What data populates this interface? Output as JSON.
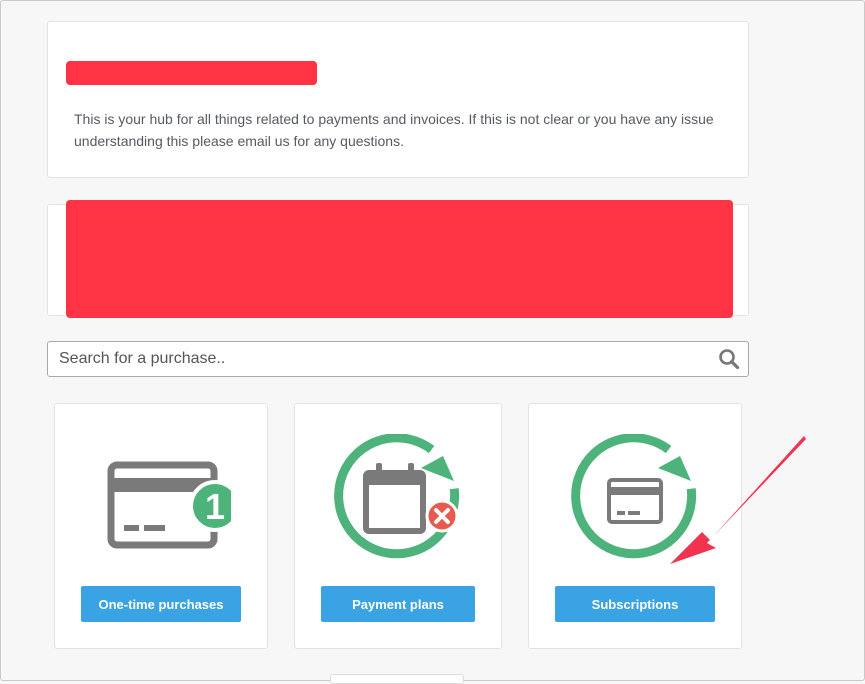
{
  "hub": {
    "description": "This is your hub for all things related to payments and invoices. If this is not clear or you have any issue understanding this please email us for any questions."
  },
  "search": {
    "placeholder": "Search for a purchase..",
    "icon": "search-icon"
  },
  "options": [
    {
      "label": "One-time purchases",
      "icon": "card-with-number-icon",
      "badge": "1"
    },
    {
      "label": "Payment plans",
      "icon": "calendar-cycle-cancel-icon"
    },
    {
      "label": "Subscriptions",
      "icon": "card-cycle-icon"
    }
  ],
  "colors": {
    "redaction": "#ff3344",
    "button": "#3aa3e3",
    "icon_gray": "#7a7a7a",
    "cycle_green": "#4db37a",
    "cancel_red": "#e85a4f",
    "annotation_arrow": "#f0334f"
  }
}
